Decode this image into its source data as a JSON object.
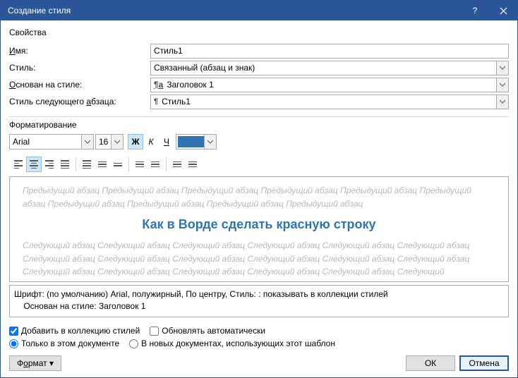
{
  "titlebar": {
    "title": "Создание стиля"
  },
  "props": {
    "group": "Свойства",
    "name_label": "Имя:",
    "name_value": "Стиль1",
    "style_label": "Стиль:",
    "style_value": "Связанный (абзац и знак)",
    "based_label": "Основан на стиле:",
    "based_value": "Заголовок 1",
    "next_label": "Стиль следующего абзаца:",
    "next_value": "Стиль1"
  },
  "format": {
    "group": "Форматирование",
    "font": "Arial",
    "size": "16",
    "bold": "Ж",
    "italic": "К",
    "underline": "Ч",
    "color": "#2e74b5"
  },
  "preview": {
    "prev_text": "Предыдущий абзац Предыдущий абзац Предыдущий абзац Предыдущий абзац Предыдущий абзац Предыдущий абзац Предыдущий абзац Предыдущий абзац Предыдущий абзац Предыдущий абзац",
    "sample": "Как в Ворде сделать красную строку",
    "next_text": "Следующий абзац Следующий абзац Следующий абзац Следующий абзац Следующий абзац Следующий абзац Следующий абзац Следующий абзац Следующий абзац Следующий абзац Следующий абзац Следующий абзац Следующий абзац Следующий абзац Следующий абзац Следующий абзац Следующий абзац Следующий"
  },
  "desc": {
    "line1": "Шрифт: (по умолчанию) Arial, полужирный, По центру, Стиль: : показывать в коллекции стилей",
    "line2": "    Основан на стиле: Заголовок 1"
  },
  "opts": {
    "add_collection": "Добавить в коллекцию стилей",
    "auto_update": "Обновлять автоматически",
    "only_doc": "Только в этом документе",
    "in_new": "В новых документах, использующих этот шаблон"
  },
  "footer": {
    "format": "Формат ▾",
    "ok": "ОК",
    "cancel": "Отмена"
  }
}
